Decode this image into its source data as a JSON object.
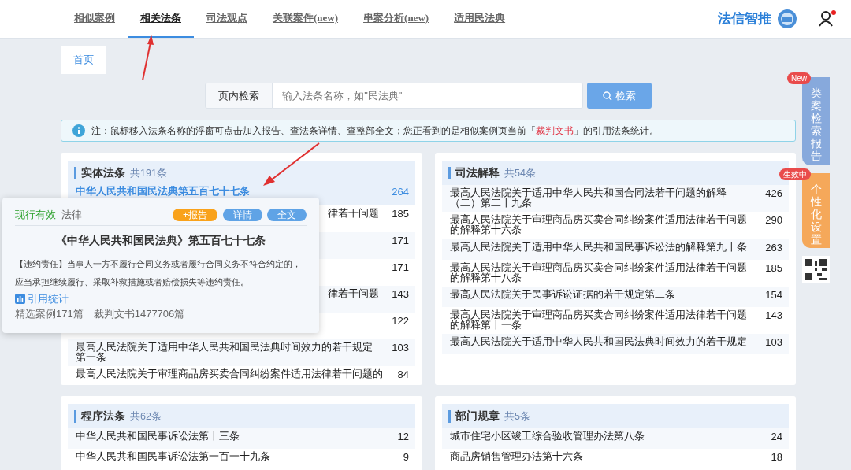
{
  "nav": {
    "tabs": [
      {
        "label": "相似案例",
        "selected": false
      },
      {
        "label": "相关法条",
        "selected": true
      },
      {
        "label": "司法观点",
        "selected": false
      },
      {
        "label": "关联案件(new)",
        "selected": false
      },
      {
        "label": "串案分析(new)",
        "selected": false
      },
      {
        "label": "适用民法典",
        "selected": false
      }
    ],
    "logo": "法信智推",
    "user_alert": true
  },
  "page_tabs": [
    {
      "label": "首页",
      "selected": true
    }
  ],
  "search": {
    "label": "页内检索",
    "placeholder": "输入法条名称，如\"民法典\"",
    "button": "检索"
  },
  "notice": {
    "before": "注：鼠标移入法条名称的浮窗可点击加入报告、查法条详情、查整部全文；您正看到的是相似案例页当前「",
    "link": "裁判文书",
    "after": "」的引用法条统计。"
  },
  "sections": [
    {
      "title": "实体法条",
      "count": "共191条",
      "rows": [
        {
          "kind": "full",
          "text": "中华人民共和国民法典第五百七十七条",
          "count": "264",
          "highlighted": true
        },
        {
          "kind": "covered",
          "text": "律若干问题",
          "count": "185",
          "highlighted": false
        },
        {
          "kind": "covered",
          "count": "171",
          "highlighted": false
        },
        {
          "kind": "covered",
          "count": "171",
          "highlighted": false
        },
        {
          "kind": "covered",
          "text": "律若干问题",
          "count": "143",
          "highlighted": false
        },
        {
          "kind": "covered",
          "count": "122",
          "highlighted": false
        },
        {
          "kind": "full",
          "text": "最高人民法院关于适用中华人民共和国民法典时间效力的若干规定第一条",
          "count": "103",
          "highlighted": false
        },
        {
          "kind": "full",
          "text": "最高人民法院关于审理商品房买卖合同纠纷案件适用法律若干问题的",
          "count": "84",
          "highlighted": false
        }
      ]
    },
    {
      "title": "司法解释",
      "count": "共54条",
      "rows": [
        {
          "kind": "full",
          "text": "最高人民法院关于适用中华人民共和国合同法若干问题的解释（二）第二十九条",
          "count": "426",
          "highlighted": false
        },
        {
          "kind": "full",
          "text": "最高人民法院关于审理商品房买卖合同纠纷案件适用法律若干问题的解释第十六条",
          "count": "290",
          "highlighted": false
        },
        {
          "kind": "full",
          "text": "最高人民法院关于适用中华人民共和国民事诉讼法的解释第九十条",
          "count": "263",
          "highlighted": false
        },
        {
          "kind": "full",
          "text": "最高人民法院关于审理商品房买卖合同纠纷案件适用法律若干问题的解释第十八条",
          "count": "185",
          "highlighted": false
        },
        {
          "kind": "full",
          "text": "最高人民法院关于民事诉讼证据的若干规定第二条",
          "count": "154",
          "highlighted": false
        },
        {
          "kind": "full",
          "text": "最高人民法院关于审理商品房买卖合同纠纷案件适用法律若干问题的解释第十一条",
          "count": "143",
          "highlighted": false
        },
        {
          "kind": "full",
          "text": "最高人民法院关于适用中华人民共和国民法典时间效力的若干规定",
          "count": "103",
          "highlighted": false
        }
      ]
    },
    {
      "title": "程序法条",
      "count": "共62条",
      "rows": [
        {
          "kind": "full",
          "text": "中华人民共和国民事诉讼法第十三条",
          "count": "12",
          "highlighted": false
        },
        {
          "kind": "full",
          "text": "中华人民共和国民事诉讼法第一百一十九条",
          "count": "9",
          "highlighted": false
        }
      ]
    },
    {
      "title": "部门规章",
      "count": "共5条",
      "rows": [
        {
          "kind": "full",
          "text": "城市住宅小区竣工综合验收管理办法第八条",
          "count": "24",
          "highlighted": false
        },
        {
          "kind": "full",
          "text": "商品房销售管理办法第十六条",
          "count": "18",
          "highlighted": false
        }
      ]
    }
  ],
  "popup": {
    "status": "现行有效",
    "type": "法律",
    "buttons": [
      {
        "label": "+报告",
        "kind": "report"
      },
      {
        "label": "详情",
        "kind": "detail"
      },
      {
        "label": "全文",
        "kind": "fulltext"
      }
    ],
    "title": "《中华人民共和国民法典》第五百七十七条",
    "body": "【违约责任】当事人一方不履行合同义务或者履行合同义务不符合约定的，应当承担继续履行、采取补救措施或者赔偿损失等违约责任。",
    "stats_link": "引用统计",
    "stats": [
      "精选案例171篇",
      "裁判文书1477706篇"
    ]
  },
  "side": [
    {
      "kind": "report",
      "label": "类案检索报告",
      "badge": "New"
    },
    {
      "kind": "settings",
      "label": "个性化设置",
      "badge": "生效中"
    }
  ]
}
